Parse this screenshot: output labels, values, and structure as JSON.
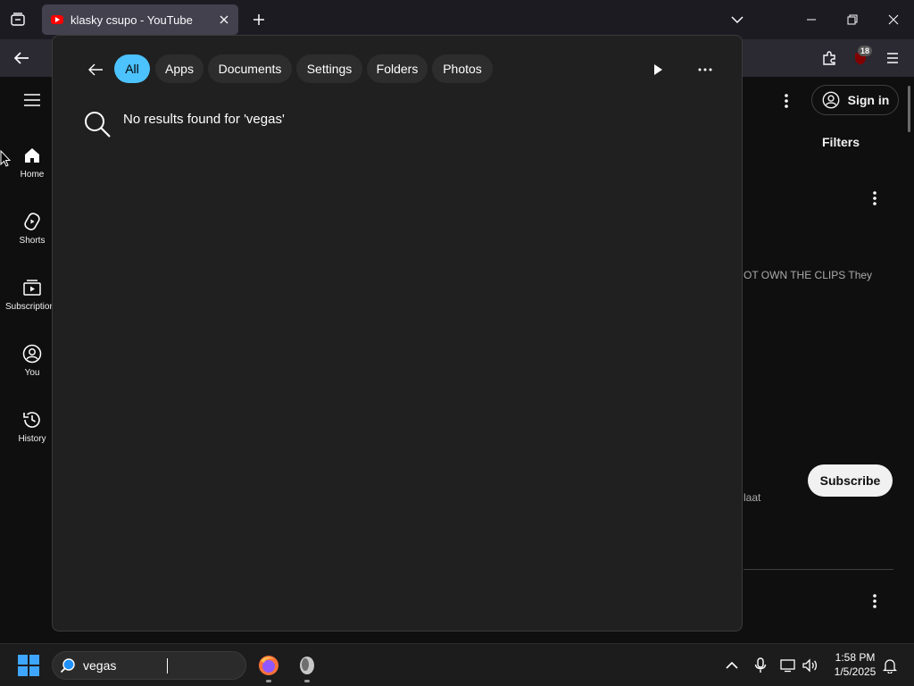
{
  "browser": {
    "tab_title": "klasky csupo - YouTube",
    "extension_badge": "18"
  },
  "youtube": {
    "guide": [
      {
        "label": "Home",
        "icon": "home-icon"
      },
      {
        "label": "Shorts",
        "icon": "shorts-icon"
      },
      {
        "label": "Subscriptions",
        "icon": "subscriptions-icon"
      },
      {
        "label": "You",
        "icon": "account-icon"
      },
      {
        "label": "History",
        "icon": "history-icon"
      }
    ],
    "sign_in": "Sign in",
    "filters": "Filters",
    "description_snippet": "OT OWN THE CLIPS They",
    "channel_snippet": "laat",
    "subscribe": "Subscribe"
  },
  "search_panel": {
    "chips": [
      {
        "label": "All",
        "active": true
      },
      {
        "label": "Apps",
        "active": false
      },
      {
        "label": "Documents",
        "active": false
      },
      {
        "label": "Settings",
        "active": false
      },
      {
        "label": "Folders",
        "active": false
      },
      {
        "label": "Photos",
        "active": false
      }
    ],
    "no_results": "No results found for 'vegas'"
  },
  "taskbar": {
    "search_value": "vegas",
    "time": "1:58 PM",
    "date": "1/5/2025"
  },
  "colors": {
    "accent": "#4cc2ff",
    "panel_bg": "#202020",
    "youtube_bg": "#0f0f0f"
  }
}
